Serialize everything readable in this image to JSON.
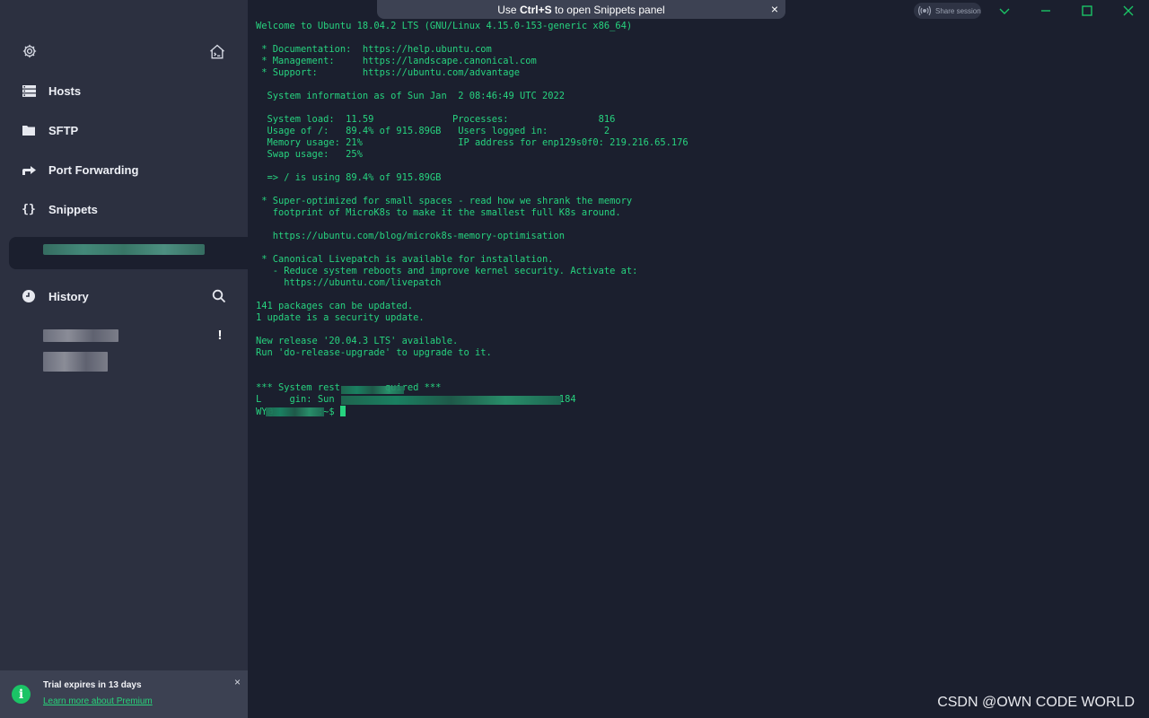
{
  "banner": {
    "prefix": "Use ",
    "shortcut": "Ctrl+S",
    "suffix": " to open Snippets panel",
    "close": "×"
  },
  "topbar": {
    "share_label": "Share session"
  },
  "sidebar": {
    "items": [
      {
        "label": "Hosts",
        "icon": "hosts-icon"
      },
      {
        "label": "SFTP",
        "icon": "folder-icon"
      },
      {
        "label": "Port Forwarding",
        "icon": "port-forwarding-icon"
      },
      {
        "label": "Snippets",
        "icon": "braces-icon"
      }
    ],
    "history_label": "History",
    "warning_mark": "!"
  },
  "trial": {
    "title": "Trial expires in 13 days",
    "link": "Learn more about Premium",
    "info_glyph": "i",
    "close": "×"
  },
  "terminal": {
    "lines": [
      "Welcome to Ubuntu 18.04.2 LTS (GNU/Linux 4.15.0-153-generic x86_64)",
      "",
      " * Documentation:  https://help.ubuntu.com",
      " * Management:     https://landscape.canonical.com",
      " * Support:        https://ubuntu.com/advantage",
      "",
      "  System information as of Sun Jan  2 08:46:49 UTC 2022",
      "",
      "  System load:  11.59              Processes:                816",
      "  Usage of /:   89.4% of 915.89GB   Users logged in:          2",
      "  Memory usage: 21%                 IP address for enp129s0f0: 219.216.65.176",
      "  Swap usage:   25%",
      "",
      "  => / is using 89.4% of 915.89GB",
      "",
      " * Super-optimized for small spaces - read how we shrank the memory",
      "   footprint of MicroK8s to make it the smallest full K8s around.",
      "",
      "   https://ubuntu.com/blog/microk8s-memory-optimisation",
      "",
      " * Canonical Livepatch is available for installation.",
      "   - Reduce system reboots and improve kernel security. Activate at:",
      "     https://ubuntu.com/livepatch",
      "",
      "141 packages can be updated.",
      "1 update is a security update.",
      "",
      "New release '20.04.3 LTS' available.",
      "Run 'do-release-upgrade' to upgrade to it.",
      "",
      "",
      "*** System rest        quired ***",
      "L     gin: Sun                                        184",
      "WY@        :~$ "
    ]
  },
  "watermark": "CSDN @OWN CODE WORLD",
  "colors": {
    "terminal_text": "#27d37f",
    "accent": "#1bc466",
    "background": "#1b1f2e",
    "sidebar": "#2c3040"
  }
}
